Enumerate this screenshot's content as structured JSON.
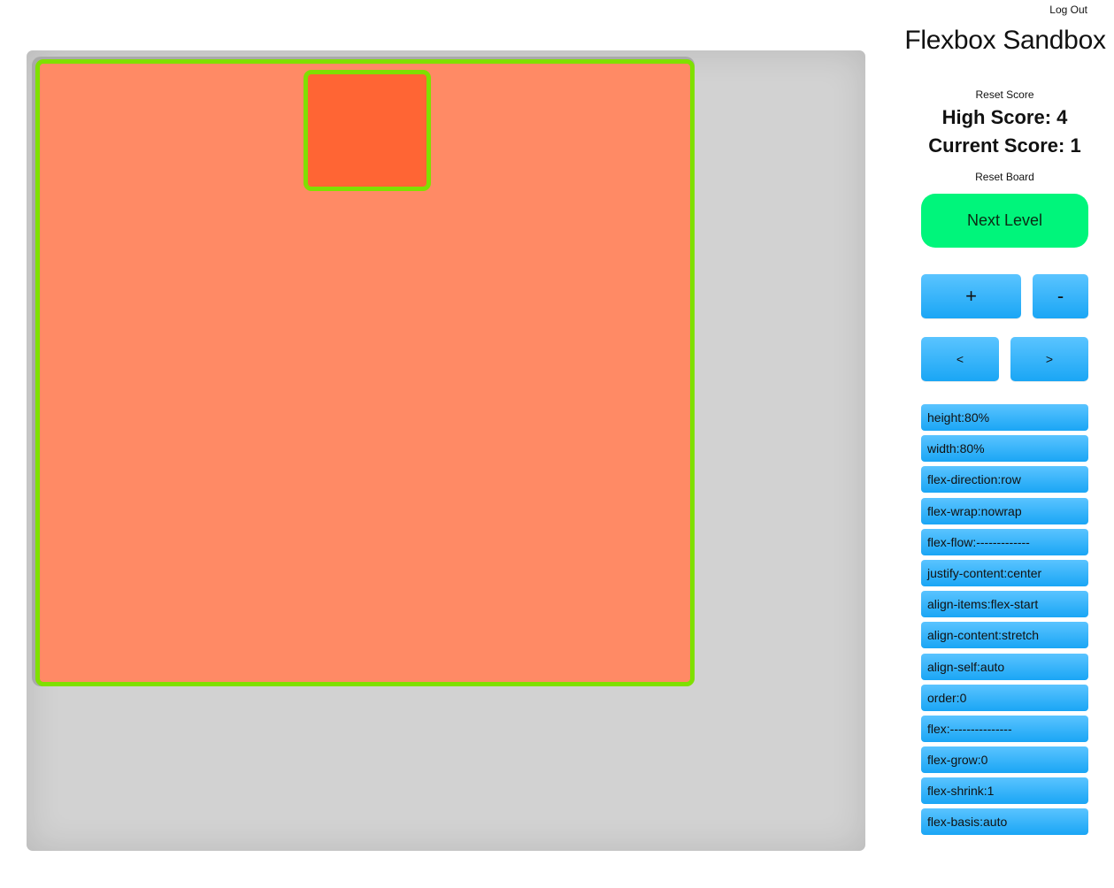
{
  "header": {
    "logout_label": "Log Out",
    "title": "Flexbox Sandbox"
  },
  "score": {
    "reset_score_label": "Reset Score",
    "high_score_text": "High Score: 4",
    "current_score_text": "Current Score: 1",
    "reset_board_label": "Reset Board"
  },
  "controls": {
    "next_level_label": "Next Level",
    "plus_label": "+",
    "minus_label": "-",
    "prev_label": "<",
    "next_label": ">"
  },
  "properties": [
    "height:80%",
    "width:80%",
    "flex-direction:row",
    "flex-wrap:nowrap",
    "flex-flow:-------------",
    "justify-content:center",
    "align-items:flex-start",
    "align-content:stretch",
    "align-self:auto",
    "order:0",
    "flex:---------------",
    "flex-grow:0",
    "flex-shrink:1",
    "flex-basis:auto"
  ],
  "colors": {
    "board_bg": "#d2d2d2",
    "container_bg": "#ff8a65",
    "item_bg": "#ff6534",
    "outline_green": "#7fe000",
    "next_level_bg": "#00f57b",
    "button_blue": "#1aa6f5"
  }
}
